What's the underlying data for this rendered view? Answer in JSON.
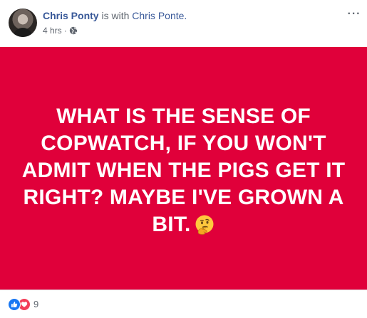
{
  "post": {
    "author": "Chris Ponty",
    "with_text": "is with",
    "tagged": "Chris Ponte.",
    "time": "4 hrs",
    "separator": "·",
    "privacy_icon": "globe-icon",
    "more_icon": "more-options-icon",
    "more_label": "···"
  },
  "image_card": {
    "background": "#e0003a",
    "text": "WHAT IS THE SENSE OF COPWATCH, IF YOU WON'T ADMIT WHEN THE PIGS GET IT RIGHT? MAYBE I'VE GROWN A BIT.",
    "emoji_icon": "thinking-face-icon"
  },
  "reactions": {
    "icons": [
      "like-icon",
      "love-icon"
    ],
    "count": "9"
  },
  "colors": {
    "link": "#385898",
    "meta": "#616770",
    "card": "#e0003a",
    "like": "#1877f2",
    "love": "#f33e58"
  }
}
